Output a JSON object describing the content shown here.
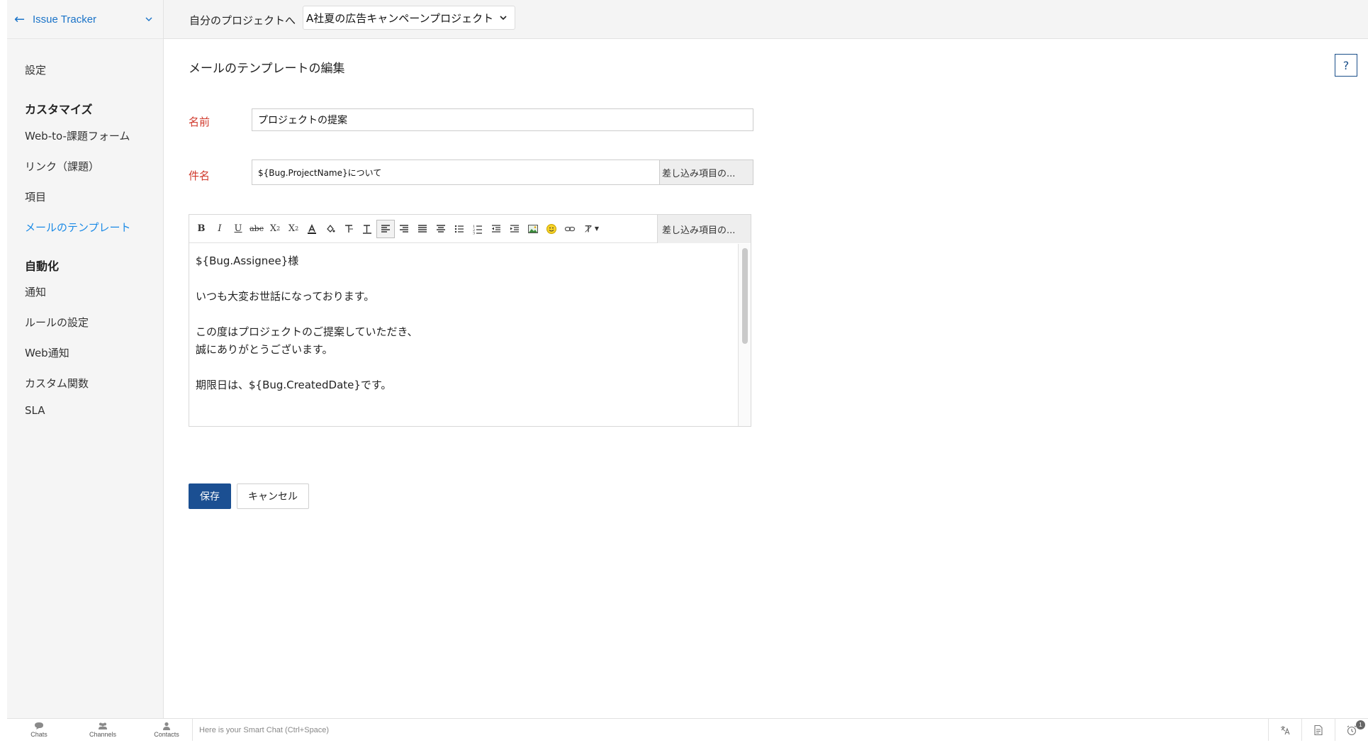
{
  "sidebar": {
    "app_title": "Issue Tracker",
    "items": [
      {
        "label": "設定",
        "type": "item"
      },
      {
        "label": "カスタマイズ",
        "type": "section"
      },
      {
        "label": "Web-to-課題フォーム",
        "type": "item"
      },
      {
        "label": "リンク（課題）",
        "type": "item"
      },
      {
        "label": "項目",
        "type": "item"
      },
      {
        "label": "メールのテンプレート",
        "type": "item",
        "active": true
      },
      {
        "label": "自動化",
        "type": "section"
      },
      {
        "label": "通知",
        "type": "item"
      },
      {
        "label": "ルールの設定",
        "type": "item"
      },
      {
        "label": "Web通知",
        "type": "item"
      },
      {
        "label": "カスタム関数",
        "type": "item"
      },
      {
        "label": "SLA",
        "type": "item"
      }
    ]
  },
  "topbar": {
    "goto_label": "自分のプロジェクトへ",
    "project_selected": "A社夏の広告キャンペーンプロジェクト"
  },
  "main": {
    "title": "メールのテンプレートの編集",
    "help_label": "?",
    "name_label": "名前",
    "name_value": "プロジェクトの提案",
    "subject_label": "件名",
    "subject_value": "${Bug.ProjectName}について",
    "merge_label": "差し込み項目の...",
    "body_lines": [
      "${Bug.Assignee}様",
      "",
      "いつも大変お世話になっております。",
      "",
      "この度はプロジェクトのご提案していただき、",
      "誠にありがとうございます。",
      "",
      "期限日は、${Bug.CreatedDate}です。"
    ],
    "save_label": "保存",
    "cancel_label": "キャンセル"
  },
  "chatbar": {
    "tabs": [
      "Chats",
      "Channels",
      "Contacts"
    ],
    "placeholder": "Here is your Smart Chat (Ctrl+Space)",
    "badge_count": "1"
  },
  "colors": {
    "accent": "#1a73c8",
    "active_link": "#1a8ae6",
    "required_label": "#d0392c",
    "primary_button": "#1b4f92"
  }
}
